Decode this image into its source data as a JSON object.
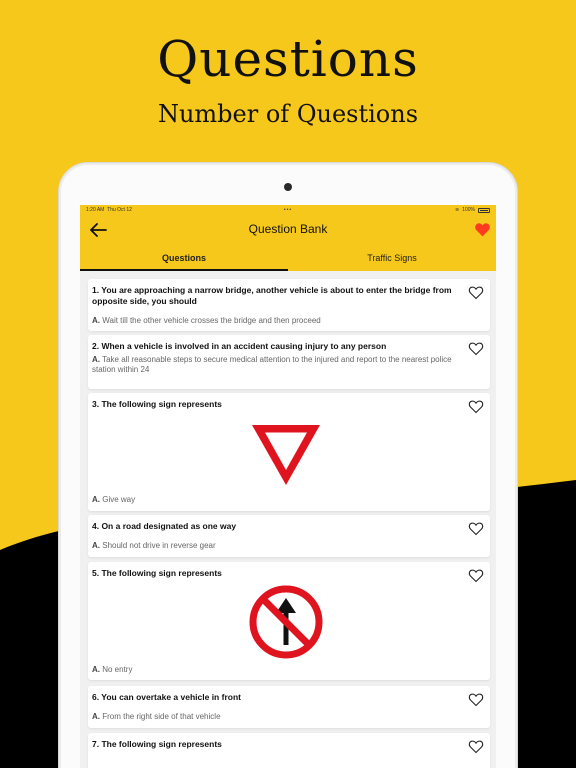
{
  "hero": {
    "title": "Questions",
    "subtitle": "Number of Questions"
  },
  "statusbar": {
    "time": "1:20 AM",
    "date": "Thu Oct 12",
    "dots": "•••",
    "battery": "100%"
  },
  "header": {
    "title": "Question Bank",
    "back_icon": "arrow-left-icon",
    "favorite_icon": "heart-filled-icon"
  },
  "tabs": [
    {
      "label": "Questions",
      "active": true
    },
    {
      "label": "Traffic Signs",
      "active": false
    }
  ],
  "questions": [
    {
      "question": "1. You are approaching a narrow bridge, another vehicle is about to enter the bridge from opposite side, you should",
      "answer_letter": "A.",
      "answer": "Wait till the other vehicle crosses the bridge and then proceed"
    },
    {
      "question": "2. When a vehicle is involved in an accident causing injury to any person",
      "answer_letter": "A.",
      "answer": "Take all reasonable steps to secure medical attention to the injured and report to the nearest police station within 24"
    },
    {
      "question": "3. The following sign represents",
      "answer_letter": "A.",
      "answer": "Give way",
      "sign": "give-way-sign"
    },
    {
      "question": "4. On a road designated as one way",
      "answer_letter": "A.",
      "answer": "Should not drive in reverse gear"
    },
    {
      "question": "5. The following sign represents",
      "answer_letter": "A.",
      "answer": "No entry",
      "sign": "no-entry-sign"
    },
    {
      "question": "6. You can overtake a vehicle in front",
      "answer_letter": "A.",
      "answer": "From the right side of that vehicle"
    },
    {
      "question": "7. The following sign represents"
    }
  ],
  "colors": {
    "brand_yellow": "#f6c81c",
    "heart_red": "#ff3b1f",
    "sign_red": "#e0141e"
  }
}
